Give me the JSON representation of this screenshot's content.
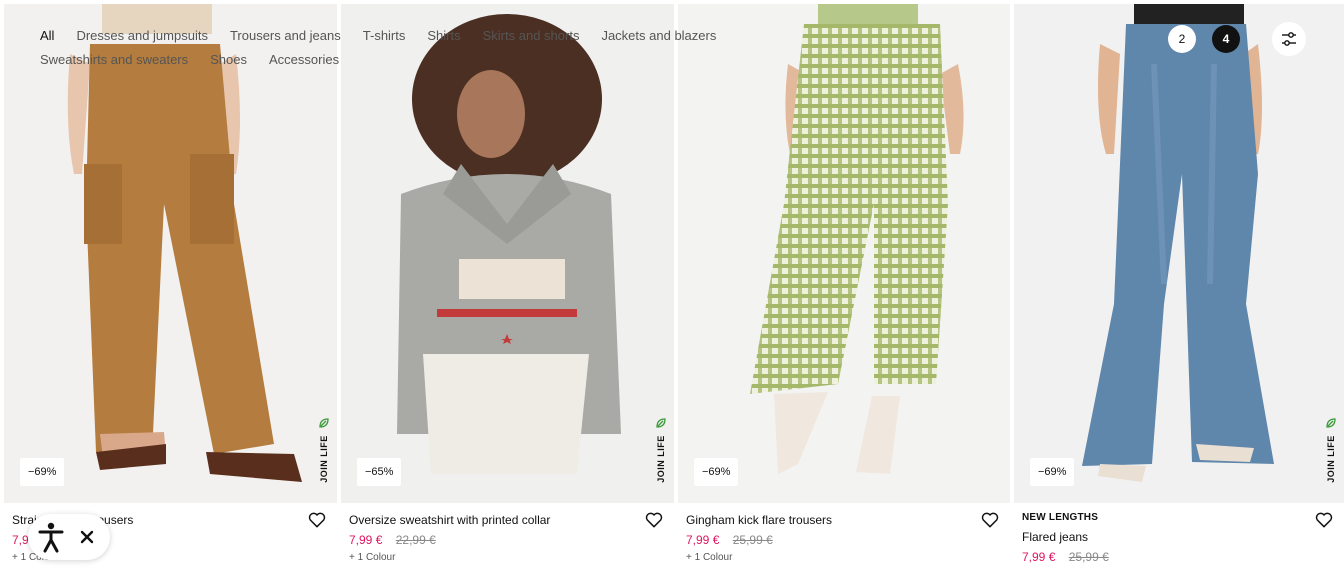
{
  "filters": {
    "items": [
      "All",
      "Dresses and jumpsuits",
      "Trousers and jeans",
      "T-shirts",
      "Shirts",
      "Skirts and shorts",
      "Jackets and blazers",
      "Sweatshirts and sweaters",
      "Shoes",
      "Accessories"
    ],
    "active": "All"
  },
  "view_controls": {
    "columns_2": "2",
    "columns_4": "4",
    "filter_icon": "sliders-icon"
  },
  "products": [
    {
      "tag": "",
      "name": "Straight cargo trousers",
      "price_now": "7,99 €",
      "price_old": "",
      "colours": "+ 1 Colour",
      "discount": "−69%",
      "join_life": "JOIN LIFE"
    },
    {
      "tag": "",
      "name": "Oversize sweatshirt with printed collar",
      "price_now": "7,99 €",
      "price_old": "22,99 €",
      "colours": "+ 1 Colour",
      "discount": "−65%",
      "join_life": "JOIN LIFE"
    },
    {
      "tag": "",
      "name": "Gingham kick flare trousers",
      "price_now": "7,99 €",
      "price_old": "25,99 €",
      "colours": "+ 1 Colour",
      "discount": "−69%",
      "join_life": ""
    },
    {
      "tag": "NEW LENGTHS",
      "name": "Flared jeans",
      "price_now": "7,99 €",
      "price_old": "25,99 €",
      "colours": "",
      "discount": "−69%",
      "join_life": "JOIN LIFE"
    }
  ],
  "accessibility_widget": {
    "person_icon": "accessibility-icon",
    "close_icon": "close-icon"
  },
  "colors": {
    "sale_price": "#e0155e",
    "join_life_green": "#3a9a3a",
    "active_toggle": "#111111"
  }
}
